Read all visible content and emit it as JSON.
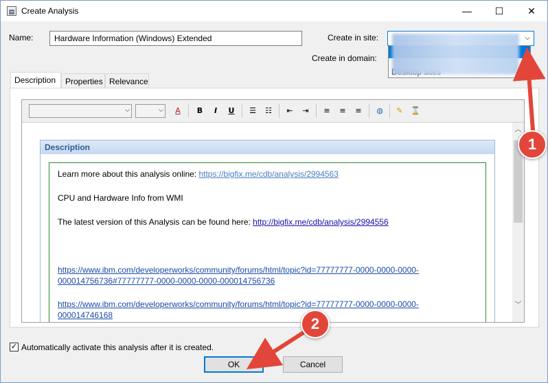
{
  "window": {
    "title": "Create Analysis",
    "minimize": "—",
    "maximize": "☐",
    "close": "✕"
  },
  "form": {
    "name_label": "Name:",
    "name_value": "Hardware Information (Windows) Extended",
    "site_label": "Create in site:",
    "domain_label": "Create in domain:",
    "dropdown_item": "Desktop sites"
  },
  "tabs": [
    {
      "label": "Description"
    },
    {
      "label": "Properties"
    },
    {
      "label": "Relevance"
    }
  ],
  "toolbar": {
    "font_color_icon": "A",
    "bold": "B",
    "italic": "I",
    "underline": "U"
  },
  "description": {
    "header": "Description",
    "line1_text": "Learn more about this analysis online: ",
    "line1_link": "https://bigfix.me/cdb/analysis/2994563",
    "line2": "CPU and Hardware Info from WMI",
    "line3_text": "The latest version of this Analysis can be found here: ",
    "line3_link": "http://bigfix.me/cdb/analysis/2994556",
    "ibm_link1_a": "https://www.ibm.com/developerworks/community/forums/html/topic?id=77777777-0000-0000-0000-",
    "ibm_link1_b": "000014756736#77777777-0000-0000-0000-000014756736",
    "ibm_link2_a": "https://www.ibm.com/developerworks/community/forums/html/topic?id=77777777-0000-0000-0000-",
    "ibm_link2_b": "000014746168"
  },
  "footer": {
    "auto_activate": "Automatically activate this analysis after it is created.",
    "auto_activate_checked": true,
    "ok": "OK",
    "cancel": "Cancel"
  },
  "annotations": {
    "badge1": "1",
    "badge2": "2",
    "badge_color": "#e2463a"
  }
}
